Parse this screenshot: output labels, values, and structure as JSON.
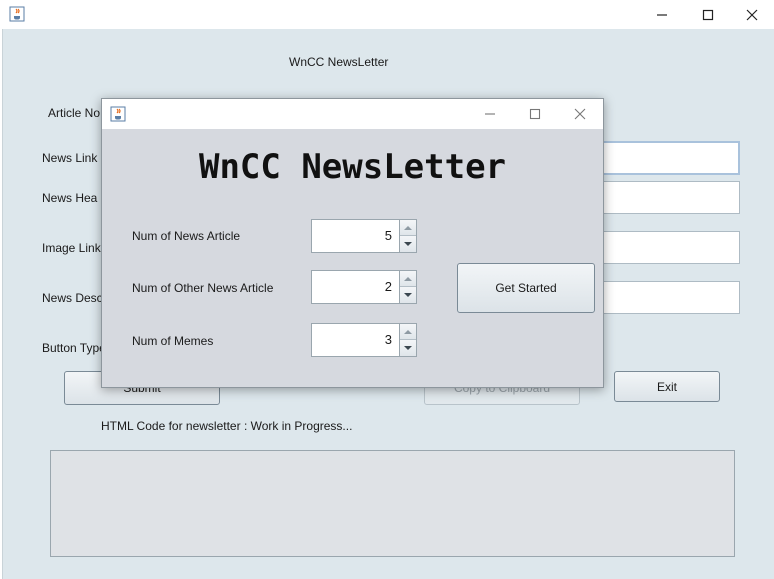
{
  "main_window": {
    "heading": "WnCC NewsLetter",
    "labels": {
      "article_no": "Article No",
      "news_link": "News Link",
      "news_heading": "News Hea",
      "image_link": "Image Link",
      "news_desc": "News Desc",
      "button_type": "Button Type"
    },
    "buttons": {
      "submit": "Submit",
      "copy": "Copy to Clipboard",
      "exit": "Exit"
    },
    "status": "HTML Code for newsletter : Work in Progress..."
  },
  "dialog": {
    "title": "WnCC NewsLetter",
    "fields": [
      {
        "label": "Num of News Article",
        "value": "5"
      },
      {
        "label": "Num of Other News Article",
        "value": "2"
      },
      {
        "label": "Num of Memes",
        "value": "3"
      }
    ],
    "get_started": "Get Started"
  },
  "icons": {
    "app": "java-coffee-icon",
    "minimize": "minimize-icon",
    "maximize": "maximize-icon",
    "close": "close-icon"
  }
}
